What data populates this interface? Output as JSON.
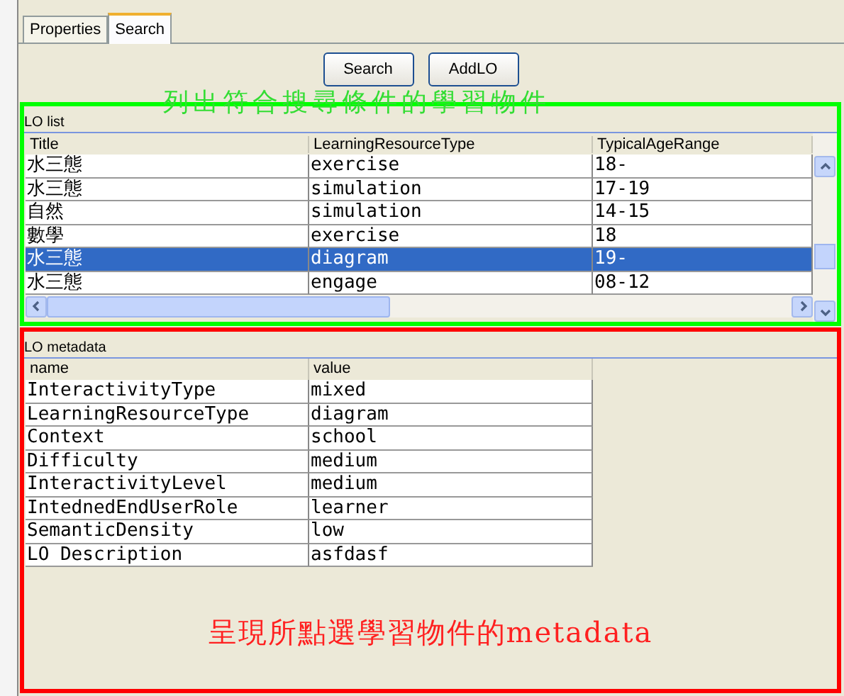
{
  "tabs": [
    {
      "label": "Properties",
      "selected": false
    },
    {
      "label": "Search",
      "selected": true
    }
  ],
  "buttons": [
    "Search",
    "AddLO"
  ],
  "lo_list": {
    "annotation": "列出符合搜尋條件的學習物件",
    "label": "LO list",
    "columns": [
      "Title",
      "LearningResourceType",
      "TypicalAgeRange"
    ],
    "rows": [
      {
        "cells": [
          "水三態",
          "exercise",
          "18-"
        ],
        "selected": false
      },
      {
        "cells": [
          "水三態",
          "simulation",
          "17-19"
        ],
        "selected": false
      },
      {
        "cells": [
          "自然",
          "simulation",
          "14-15"
        ],
        "selected": false
      },
      {
        "cells": [
          "數學",
          "exercise",
          "18"
        ],
        "selected": false
      },
      {
        "cells": [
          "水三態",
          "diagram",
          "19-"
        ],
        "selected": true
      },
      {
        "cells": [
          "水三態",
          "engage",
          "08-12"
        ],
        "selected": false
      }
    ]
  },
  "lo_metadata": {
    "label": "LO metadata",
    "annotation": "呈現所點選學習物件的metadata",
    "columns": [
      "name",
      "value"
    ],
    "rows": [
      [
        "InteractivityType",
        "mixed"
      ],
      [
        "LearningResourceType",
        "diagram"
      ],
      [
        "Context",
        "school"
      ],
      [
        "Difficulty",
        "medium"
      ],
      [
        "InteractivityLevel",
        "medium"
      ],
      [
        "IntednedEndUserRole",
        "learner"
      ],
      [
        "SemanticDensity",
        "low"
      ],
      [
        "LO Description",
        "asfdasf"
      ]
    ]
  }
}
